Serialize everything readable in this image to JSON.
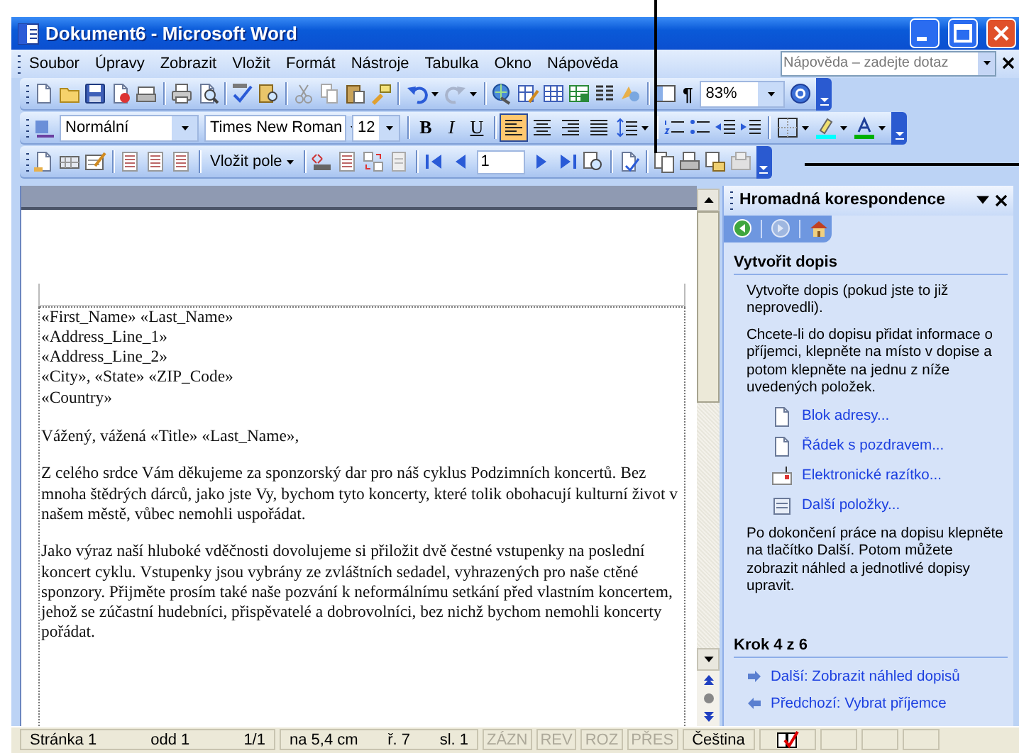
{
  "window": {
    "title": "Dokument6 - Microsoft Word"
  },
  "menu": [
    "Soubor",
    "Úpravy",
    "Zobrazit",
    "Vložit",
    "Formát",
    "Nástroje",
    "Tabulka",
    "Okno",
    "Nápověda"
  ],
  "help_box": {
    "placeholder": "Nápověda – zadejte dotaz"
  },
  "standard_toolbar": {
    "show_marks": "¶",
    "zoom": "83%"
  },
  "formatting_toolbar": {
    "style": "Normální",
    "font": "Times New Roman",
    "size": "12",
    "format_buttons": [
      {
        "label": "B",
        "on": false
      },
      {
        "label": "I",
        "on": false
      },
      {
        "label": "U",
        "on": false
      }
    ],
    "alignment": [
      {
        "selected": true
      },
      {
        "selected": false
      },
      {
        "selected": false
      },
      {
        "selected": false
      }
    ]
  },
  "mail_merge_toolbar": {
    "insert_field": "Vložit pole",
    "record": "1"
  },
  "document": {
    "address_lines": [
      "«First_Name» «Last_Name»",
      "«Address_Line_1»",
      "«Address_Line_2»",
      "«City», «State» «ZIP_Code»",
      "«Country»"
    ],
    "salutation": "Vážený, vážená «Title» «Last_Name»,",
    "paragraphs": [
      "Z celého srdce Vám děkujeme za sponzorský dar pro náš cyklus Podzimních koncertů. Bez mnoha štědrých dárců, jako jste Vy, bychom tyto koncerty, které tolik obohacují kulturní život v našem městě, vůbec nemohli uspořádat.",
      "Jako výraz naší hluboké vděčnosti dovolujeme si přiložit dvě čestné vstupenky na poslední koncert cyklu. Vstupenky jsou vybrány ze zvláštních sedadel, vyhrazených pro naše ctěné sponzory. Přijměte prosím také naše pozvání k neformálnímu setkání před vlastním koncertem, jehož se zúčastní hudebníci, přispěvatelé a dobrovolníci, bez nichž bychom nemohli koncerty pořádat."
    ]
  },
  "task_pane": {
    "title": "Hromadná korespondence",
    "section": "Vytvořit dopis",
    "intro": "Vytvořte dopis (pokud jste to již neprovedli).",
    "instructions": "Chcete-li do dopisu přidat informace o příjemci, klepněte na místo v dopise a potom klepněte na jednu z níže uvedených položek.",
    "links": [
      {
        "kind": "address",
        "label": "Blok adresy..."
      },
      {
        "kind": "greeting",
        "label": "Řádek s pozdravem..."
      },
      {
        "kind": "postage",
        "label": "Elektronické razítko..."
      },
      {
        "kind": "more",
        "label": "Další položky..."
      }
    ],
    "outro": "Po dokončení práce na dopisu klepněte na tlačítko Další. Potom můžete zobrazit náhled a jednotlivé dopisy upravit.",
    "step": "Krok 4 z 6",
    "nav": [
      {
        "kind": "next",
        "label": "Další: Zobrazit náhled dopisů"
      },
      {
        "kind": "previous",
        "label": "Předchozí: Vybrat příjemce"
      }
    ]
  },
  "status_bar": {
    "cells": [
      "Stránka 1",
      "odd 1",
      "1/1",
      "na 5,4 cm",
      "ř. 7",
      "sl. 1"
    ],
    "modes": [
      {
        "label": "ZÁZN",
        "on": false
      },
      {
        "label": "REV",
        "on": false
      },
      {
        "label": "ROZ",
        "on": false
      },
      {
        "label": "PŘES",
        "on": false
      }
    ],
    "language": "Čeština"
  }
}
